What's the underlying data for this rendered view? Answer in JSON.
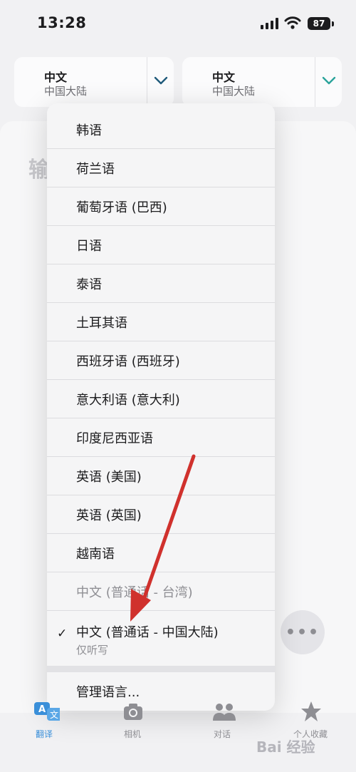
{
  "status_bar": {
    "time": "13:28",
    "battery": "87"
  },
  "source_lang": {
    "name": "中文",
    "region": "中国大陆"
  },
  "target_lang": {
    "name": "中文",
    "region": "中国大陆"
  },
  "input_placeholder": "输",
  "menu": {
    "items": [
      "韩语",
      "荷兰语",
      "葡萄牙语 (巴西)",
      "日语",
      "泰语",
      "土耳其语",
      "西班牙语 (西班牙)",
      "意大利语 (意大利)",
      "印度尼西亚语",
      "英语 (美国)",
      "英语 (英国)",
      "越南语",
      "中文 (普通话 - 台湾)"
    ],
    "selected": {
      "label": "中文 (普通话 - 中国大陆)",
      "sublabel": "仅听写",
      "checkmark": "✓"
    },
    "manage": "管理语言..."
  },
  "more_button": "•••",
  "tabs": [
    {
      "label": "翻译",
      "icon": "translate-icon",
      "active": true
    },
    {
      "label": "相机",
      "icon": "camera-icon",
      "active": false
    },
    {
      "label": "对话",
      "icon": "conversation-icon",
      "active": false
    },
    {
      "label": "个人收藏",
      "icon": "star-icon",
      "active": false
    }
  ],
  "watermark": "Bai 经验",
  "colors": {
    "accent": "#3a8fd9",
    "annotation_arrow": "#d0312d",
    "chevron_teal": "#2aa39b"
  }
}
